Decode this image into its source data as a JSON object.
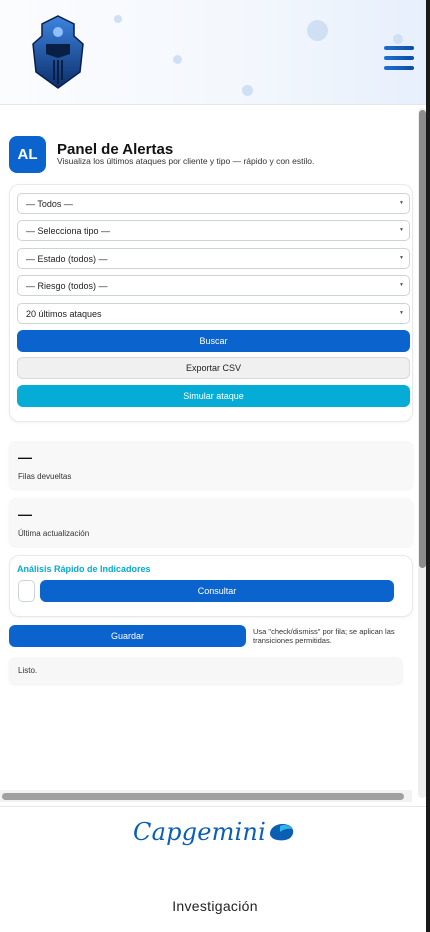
{
  "header": {
    "logo_icon": "knight-helmet-icon",
    "menu_icon": "hamburger-menu-icon",
    "accent": "#0b63ce"
  },
  "panel": {
    "badge": "AL",
    "title": "Panel de Alertas",
    "subtitle": "Visualiza los últimos ataques por cliente y tipo — rápido y con estilo."
  },
  "filters": {
    "client": "— Todos —",
    "type": "— Selecciona tipo —",
    "state": "— Estado (todos) —",
    "risk": "— Riesgo (todos) —",
    "limit": "20 últimos ataques"
  },
  "actions": {
    "search": "Buscar",
    "export": "Exportar CSV",
    "simulate": "Simular ataque"
  },
  "stats": {
    "rows_value": "—",
    "rows_label": "Filas devueltas",
    "updated_value": "—",
    "updated_label": "Última actualización"
  },
  "quick_analysis": {
    "title": "Análisis Rápido de Indicadores",
    "input_value": "",
    "consult": "Consultar"
  },
  "save": {
    "label": "Guardar",
    "note": "Usa \"check/dismiss\" por fila; se aplican las transiciones permitidas."
  },
  "status_text": "Listo.",
  "footer": {
    "brand": "Capgemini",
    "brand_icon": "capgemini-spade-icon",
    "caption": "Investigación"
  },
  "colors": {
    "primary": "#0b63ce",
    "cyan": "#05acd6",
    "analysis_title": "#07a9d6"
  }
}
